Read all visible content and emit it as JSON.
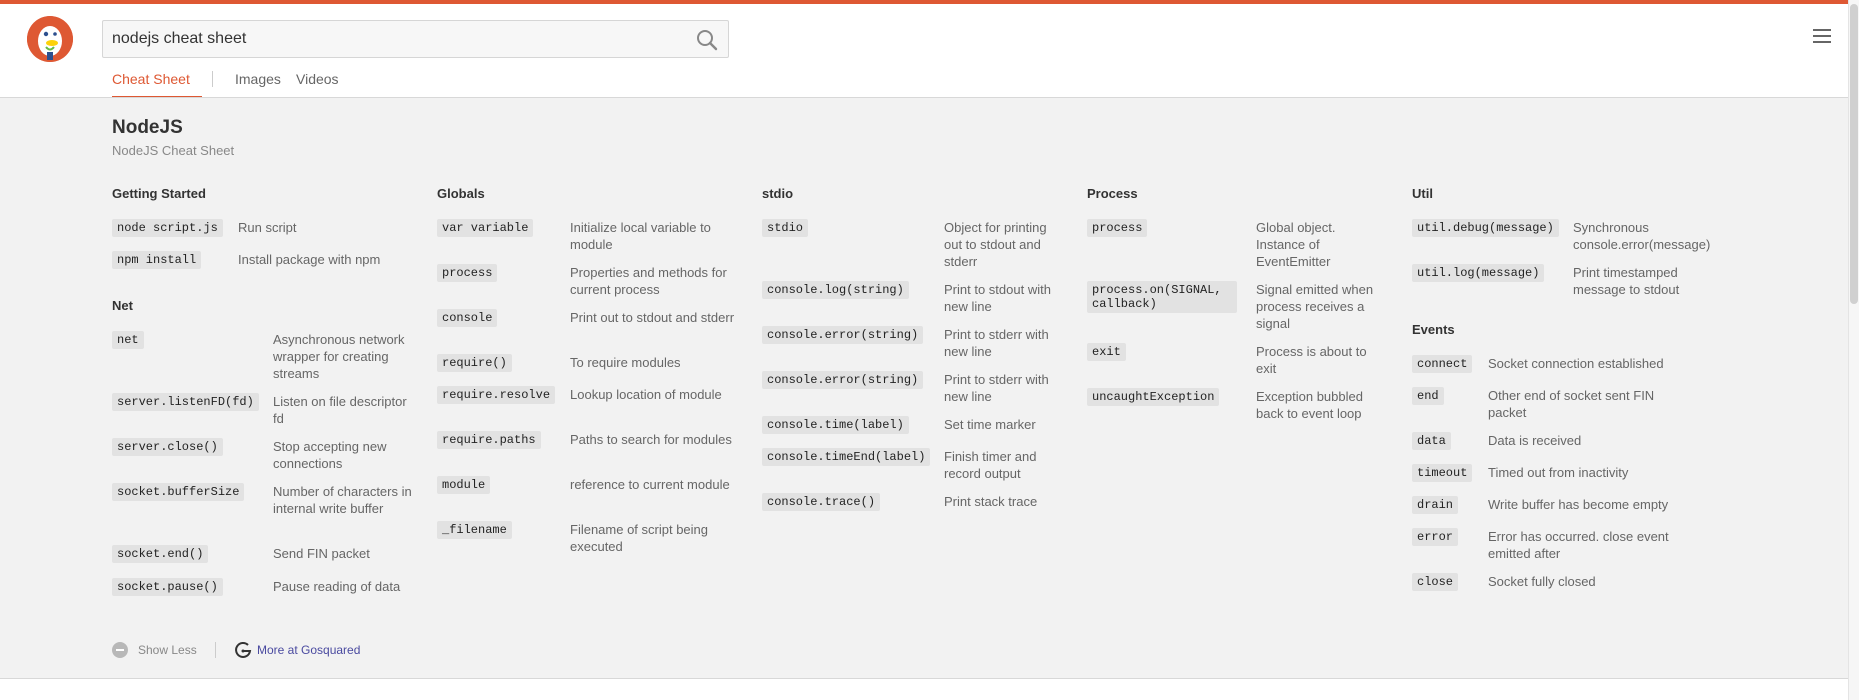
{
  "search": {
    "query": "nodejs cheat sheet"
  },
  "tabs": [
    {
      "label": "Cheat Sheet"
    },
    {
      "label": "Images"
    },
    {
      "label": "Videos"
    }
  ],
  "cheatsheet": {
    "title": "NodeJS",
    "subtitle": "NodeJS Cheat Sheet",
    "sections": {
      "getting_started": {
        "title": "Getting Started",
        "items": [
          {
            "code": "node script.js",
            "desc": "Run script"
          },
          {
            "code": "npm install",
            "desc": "Install package with npm"
          }
        ]
      },
      "net": {
        "title": "Net",
        "items": [
          {
            "code": "net",
            "desc": "Asynchronous network wrapper for creating streams"
          },
          {
            "code": "server.listenFD(fd)",
            "desc": "Listen on file descriptor fd"
          },
          {
            "code": "server.close()",
            "desc": "Stop accepting new connections"
          },
          {
            "code": "socket.bufferSize",
            "desc": "Number of characters in internal write buffer"
          },
          {
            "code": "socket.end()",
            "desc": "Send FIN packet"
          },
          {
            "code": "socket.pause()",
            "desc": "Pause reading of data"
          }
        ]
      },
      "globals": {
        "title": "Globals",
        "items": [
          {
            "code": "var variable",
            "desc": "Initialize local variable to module"
          },
          {
            "code": "process",
            "desc": "Properties and methods for current process"
          },
          {
            "code": "console",
            "desc": "Print out to stdout and stderr"
          },
          {
            "code": "require()",
            "desc": "To require modules"
          },
          {
            "code": "require.resolve",
            "desc": "Lookup location of module"
          },
          {
            "code": "require.paths",
            "desc": "Paths to search for modules"
          },
          {
            "code": "module",
            "desc": "reference to current module"
          },
          {
            "code": "_filename",
            "desc": "Filename of script being executed"
          }
        ]
      },
      "stdio": {
        "title": "stdio",
        "items": [
          {
            "code": "stdio",
            "desc": "Object for printing out to stdout and stderr"
          },
          {
            "code": "console.log(string)",
            "desc": "Print to stdout with new line"
          },
          {
            "code": "console.error(string)",
            "desc": "Print to stderr with new line"
          },
          {
            "code": "console.error(string)",
            "desc": "Print to stderr with new line"
          },
          {
            "code": "console.time(label)",
            "desc": "Set time marker"
          },
          {
            "code": "console.timeEnd(label)",
            "desc": "Finish timer and record output"
          },
          {
            "code": "console.trace()",
            "desc": "Print stack trace"
          }
        ]
      },
      "process": {
        "title": "Process",
        "items": [
          {
            "code": "process",
            "desc": "Global object. Instance of EventEmitter"
          },
          {
            "code": "process.on(SIGNAL, callback)",
            "desc": "Signal emitted when process receives a signal"
          },
          {
            "code": "exit",
            "desc": "Process is about to exit"
          },
          {
            "code": "uncaughtException",
            "desc": "Exception bubbled back to event loop"
          }
        ]
      },
      "util": {
        "title": "Util",
        "items": [
          {
            "code": "util.debug(message)",
            "desc": "Synchronous console.error(message)"
          },
          {
            "code": "util.log(message)",
            "desc": "Print timestamped message to stdout"
          }
        ]
      },
      "events": {
        "title": "Events",
        "items": [
          {
            "code": "connect",
            "desc": "Socket connection established"
          },
          {
            "code": "end",
            "desc": "Other end of socket sent FIN packet"
          },
          {
            "code": "data",
            "desc": "Data is received"
          },
          {
            "code": "timeout",
            "desc": "Timed out from inactivity"
          },
          {
            "code": "drain",
            "desc": "Write buffer has become empty"
          },
          {
            "code": "error",
            "desc": "Error has occurred. close event emitted after"
          },
          {
            "code": "close",
            "desc": "Socket fully closed"
          }
        ]
      }
    }
  },
  "footer": {
    "show_less": "Show Less",
    "more_link": "More at Gosquared"
  }
}
